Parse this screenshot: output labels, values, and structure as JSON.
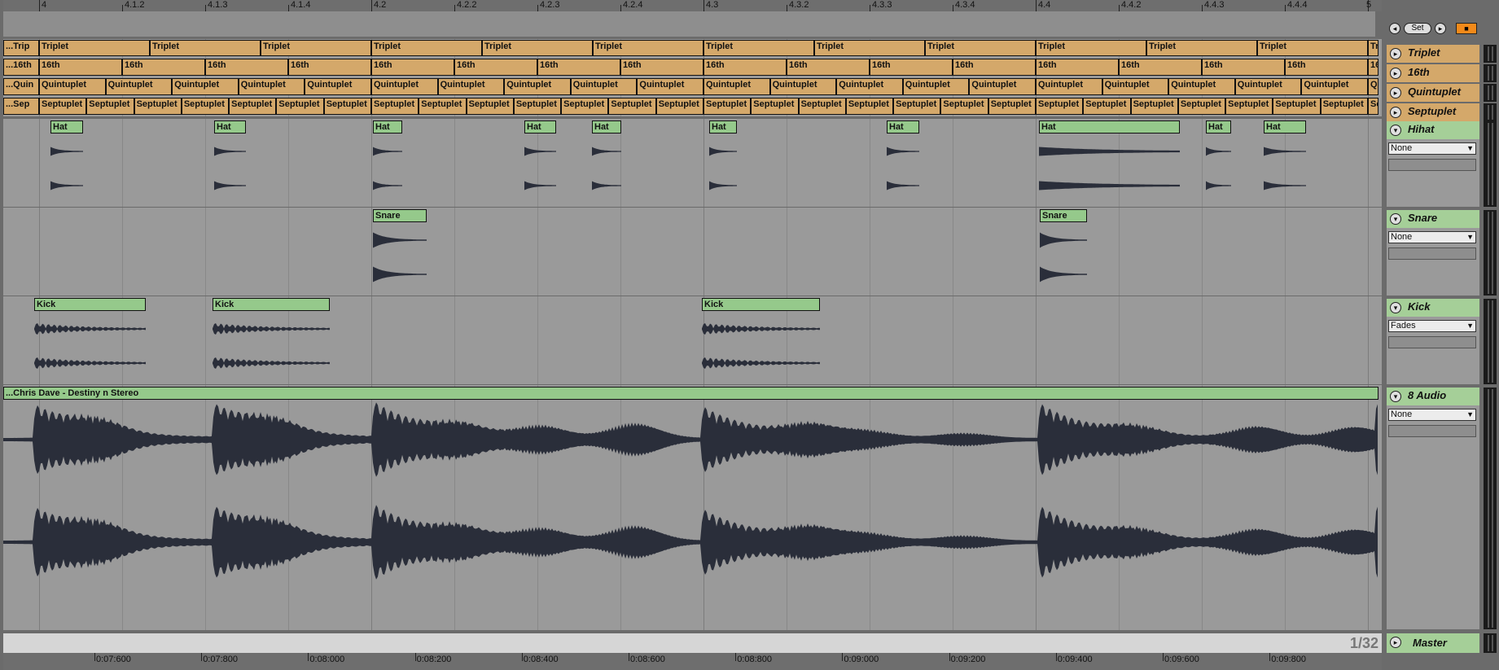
{
  "ruler_marks": [
    "4",
    "4.1.2",
    "4.1.3",
    "4.1.4",
    "4.2",
    "4.2.2",
    "4.2.3",
    "4.2.4",
    "4.3",
    "4.3.2",
    "4.3.3",
    "4.3.4",
    "4.4",
    "4.4.2",
    "4.4.3",
    "4.4.4",
    "5"
  ],
  "time_marks": [
    "0:07:600",
    "0:07:800",
    "0:08:000",
    "0:08:200",
    "0:08:400",
    "0:08:600",
    "0:08:800",
    "0:09:000",
    "0:09:200",
    "0:09:400",
    "0:09:600",
    "0:09:800"
  ],
  "loop_controls": {
    "set_label": "Set"
  },
  "zoom_label": "1/32",
  "tracks": {
    "triplet": {
      "name": "Triplet",
      "clip_label": "Triplet",
      "edge_label": "...Trip"
    },
    "sixteenth": {
      "name": "16th",
      "clip_label": "16th",
      "edge_label": "...16th"
    },
    "quintuplet": {
      "name": "Quintuplet",
      "clip_label": "Quintuplet",
      "edge_label": "...Quin"
    },
    "septuplet": {
      "name": "Septuplet",
      "clip_label": "Septuplet",
      "edge_label": "...Sep"
    },
    "hihat": {
      "name": "Hihat",
      "clip_label": "Hat",
      "dropdown": "None"
    },
    "snare": {
      "name": "Snare",
      "clip_label": "Snare",
      "dropdown": "None"
    },
    "kick": {
      "name": "Kick",
      "clip_label": "Kick",
      "dropdown": "Fades"
    },
    "audio": {
      "name": "8 Audio",
      "clip_label": "...Chris Dave - Destiny n Stereo",
      "dropdown": "None"
    },
    "master": {
      "name": "Master"
    }
  },
  "colors": {
    "grid_clip": "#d4a86a",
    "audio_clip": "#95c98b",
    "waveform": "#2a2e3a",
    "lane": "#9a9a9a"
  }
}
